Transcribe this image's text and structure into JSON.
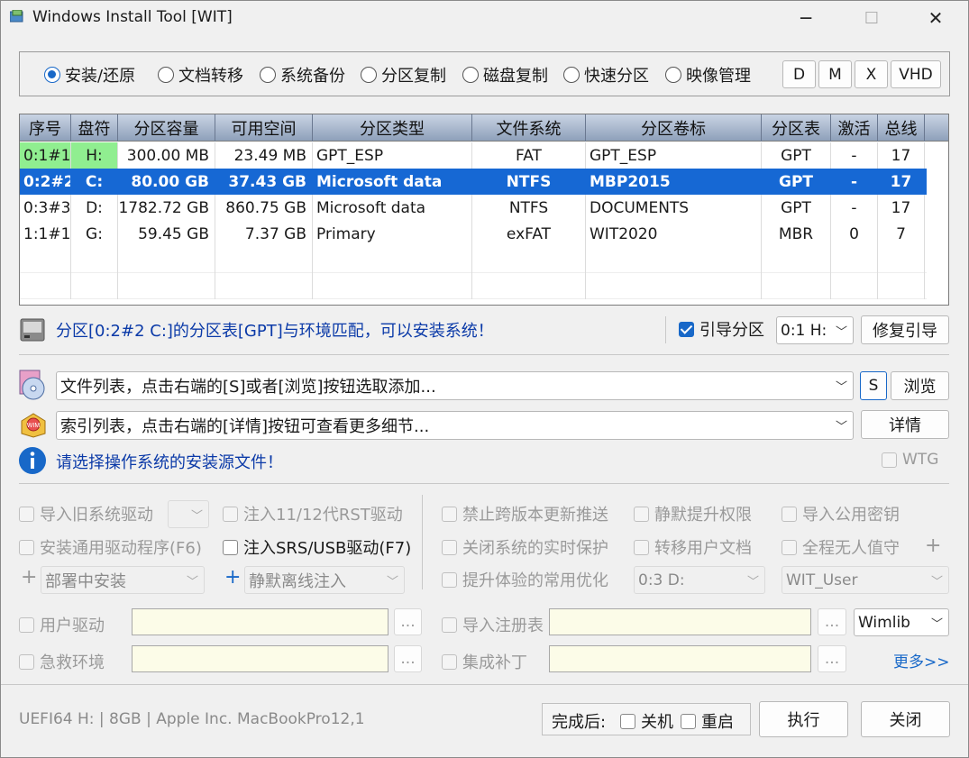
{
  "window": {
    "title": "Windows Install Tool [WIT]",
    "minimize": "─",
    "maximize": "☐",
    "close": "✕"
  },
  "modes": [
    {
      "label": "安装/还原",
      "selected": true
    },
    {
      "label": "文档转移",
      "selected": false
    },
    {
      "label": "系统备份",
      "selected": false
    },
    {
      "label": "分区复制",
      "selected": false
    },
    {
      "label": "磁盘复制",
      "selected": false
    },
    {
      "label": "快速分区",
      "selected": false
    },
    {
      "label": "映像管理",
      "selected": false
    }
  ],
  "mode_buttons": [
    "D",
    "M",
    "X",
    "VHD"
  ],
  "table": {
    "headers": [
      "序号",
      "盘符",
      "分区容量",
      "可用空间",
      "分区类型",
      "文件系统",
      "分区卷标",
      "分区表",
      "激活",
      "总线"
    ],
    "rows": [
      [
        "0:1#1",
        "H:",
        "300.00 MB",
        "23.49 MB",
        "GPT_ESP",
        "FAT",
        "GPT_ESP",
        "GPT",
        "-",
        "17"
      ],
      [
        "0:2#2",
        "C:",
        "80.00 GB",
        "37.43 GB",
        "Microsoft data",
        "NTFS",
        "MBP2015",
        "GPT",
        "-",
        "17"
      ],
      [
        "0:3#3",
        "D:",
        "1782.72 GB",
        "860.75 GB",
        "Microsoft data",
        "NTFS",
        "DOCUMENTS",
        "GPT",
        "-",
        "17"
      ],
      [
        "1:1#1",
        "G:",
        "59.45 GB",
        "7.37 GB",
        "Primary",
        "exFAT",
        "WIT2020",
        "MBR",
        "0",
        "7"
      ]
    ]
  },
  "partition_status": "分区[0:2#2 C:]的分区表[GPT]与环境匹配，可以安装系统！",
  "boot_partition": {
    "label": "引导分区",
    "checked": true,
    "value": "0:1 H:",
    "repair_label": "修复引导"
  },
  "file_list": {
    "placeholder": "文件列表，点击右端的[S]或者[浏览]按钮选取添加...",
    "s_label": "S",
    "browse_label": "浏览"
  },
  "index_list": {
    "placeholder": "索引列表，点击右端的[详情]按钮可查看更多细节...",
    "details_label": "详情"
  },
  "info_text": "请选择操作系统的安装源文件！",
  "wtg_label": "WTG",
  "options": {
    "import_old_drivers": "导入旧系统驱动",
    "inject_rst": "注入11/12代RST驱动",
    "install_generic_drivers": "安装通用驱动程序(F6)",
    "inject_srs_usb": "注入SRS/USB驱动(F7)",
    "deploy_install": "部署中安装",
    "silent_offline_inject": "静默离线注入",
    "block_upgrade_push": "禁止跨版本更新推送",
    "silent_elevate": "静默提升权限",
    "import_public_key": "导入公用密钥",
    "disable_realtime_protection": "关闭系统的实时保护",
    "transfer_user_docs": "转移用户文档",
    "unattended": "全程无人值守",
    "common_optimization": "提升体验的常用优化",
    "target_partition": "0:3 D:",
    "username": "WIT_User",
    "user_drivers": "用户驱动",
    "import_registry": "导入注册表",
    "rescue_env": "急救环境",
    "integrate_patches": "集成补丁",
    "wim_engine": "Wimlib",
    "more_link": "更多>>",
    "ellipsis": "..."
  },
  "footer": {
    "system_info": "UEFI64 H: | 8GB | Apple Inc. MacBookPro12,1",
    "after_done_label": "完成后:",
    "shutdown_label": "关机",
    "restart_label": "重启",
    "execute_label": "执行",
    "close_label": "关闭"
  },
  "colors": {
    "selection": "#1668d4",
    "esp_highlight": "#90ee90",
    "accent": "#1868c8"
  }
}
